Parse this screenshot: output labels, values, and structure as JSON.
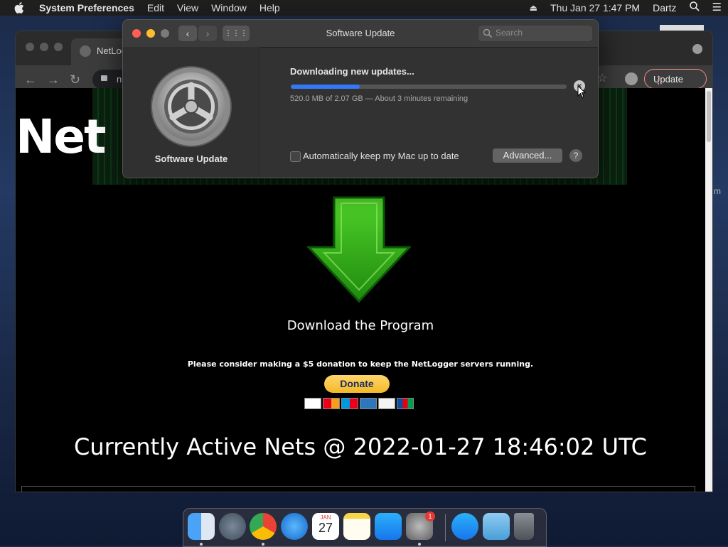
{
  "menubar": {
    "app_name": "System Preferences",
    "menus": [
      "Edit",
      "View",
      "Window",
      "Help"
    ],
    "datetime": "Thu Jan 27  1:47 PM",
    "user": "Dartz"
  },
  "chrome": {
    "tab_title": "NetLog",
    "omnibox_text": "n",
    "update_label": "Update"
  },
  "page": {
    "banner_logo": "Net",
    "download_label": "Download the Program",
    "donation_text": "Please consider making a $5 donation to keep the NetLogger servers running.",
    "donate_label": "Donate",
    "cards": [
      "VISA",
      "Mastercard",
      "Maestro",
      "AmEx",
      "Discover",
      "JCB"
    ],
    "active_title": "Currently Active Nets @ 2022-01-27 18:46:02 UTC"
  },
  "software_update": {
    "title": "Software Update",
    "search_placeholder": "Search",
    "app_label": "Software Update",
    "status": "Downloading new updates...",
    "progress": 0.25,
    "detail": "520.0 MB of 2.07 GB — About 3 minutes remaining",
    "auto_update_label": "Automatically keep my Mac up to date",
    "auto_update_checked": false,
    "advanced_label": "Advanced...",
    "help_label": "?"
  },
  "dock": {
    "items": [
      "Finder",
      "Launchpad",
      "Google Chrome",
      "Safari",
      "Calendar",
      "Notes",
      "App Store",
      "System Preferences",
      "App Store",
      "Downloads",
      "Trash"
    ],
    "calendar_month": "JAN",
    "calendar_day": "27",
    "badge": "1"
  },
  "side_fragment": "m",
  "colors": {
    "progress_blue": "#3478f6",
    "donate_yellow": "#f4b92a",
    "arrow_green": "#3fbf1a"
  }
}
